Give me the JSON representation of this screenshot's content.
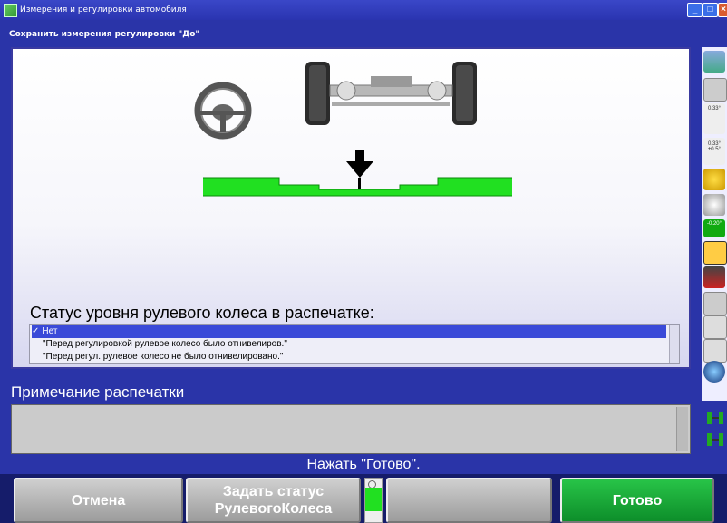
{
  "window": {
    "title": "Измерения и регулировки автомобиля",
    "subtitle": "Сохранить измерения регулировки \"До\"",
    "minimize_glyph": "_",
    "maximize_glyph": "□",
    "close_glyph": "×"
  },
  "main": {
    "status_heading": "Статус уровня рулевого колеса в распечатке:",
    "options": [
      {
        "label": "Нет",
        "selected": true
      },
      {
        "label": "\"Перед регулировкой рулевое колесо было отнивелиров.\"",
        "selected": false
      },
      {
        "label": "\"Перед регул. рулевое колесо не было отнивелировано.\"",
        "selected": false
      }
    ],
    "check_mark": "✓"
  },
  "right_tools": {
    "readouts": [
      "0.33°",
      "0.33°",
      "±0.5°",
      "-0.20°"
    ]
  },
  "notes": {
    "label": "Примечание распечатки",
    "value": ""
  },
  "prompt": "Нажать \"Готово\".",
  "buttons": {
    "cancel": "Отмена",
    "set_status_line1": "Задать статус",
    "set_status_line2": "РулевогоКолеса",
    "empty": "",
    "done": "Готово"
  },
  "colors": {
    "background_blue": "#2a34a8",
    "level_green": "#21e021",
    "done_green": "#1aa83a",
    "selection_blue": "#3a4ad8"
  },
  "icons": {
    "window_icon": "app-icon",
    "level_pointer": "down-arrow-icon"
  }
}
